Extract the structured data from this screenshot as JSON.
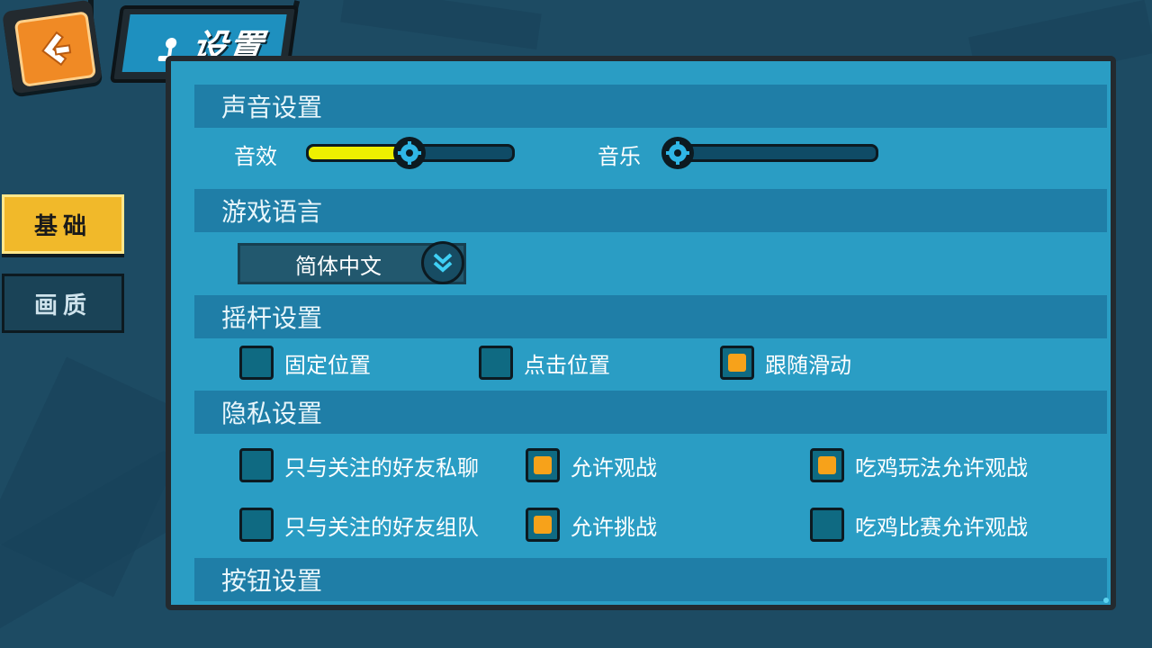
{
  "header": {
    "title": "设置",
    "back_icon": "back-arrow-icon",
    "title_icon": "joystick-icon"
  },
  "tabs": [
    {
      "label": "基础",
      "active": true
    },
    {
      "label": "画质",
      "active": false
    }
  ],
  "sections": {
    "sound": {
      "title": "声音设置",
      "effects_label": "音效",
      "effects_value": 0.48,
      "music_label": "音乐",
      "music_value": 0.0
    },
    "language": {
      "title": "游戏语言",
      "selected": "简体中文"
    },
    "joystick": {
      "title": "摇杆设置",
      "options": [
        {
          "label": "固定位置",
          "checked": false
        },
        {
          "label": "点击位置",
          "checked": false
        },
        {
          "label": "跟随滑动",
          "checked": true
        }
      ]
    },
    "privacy": {
      "title": "隐私设置",
      "options": [
        {
          "label": "只与关注的好友私聊",
          "checked": false
        },
        {
          "label": "允许观战",
          "checked": true
        },
        {
          "label": "吃鸡玩法允许观战",
          "checked": true
        },
        {
          "label": "只与关注的好友组队",
          "checked": false
        },
        {
          "label": "允许挑战",
          "checked": true
        },
        {
          "label": "吃鸡比赛允许观战",
          "checked": false
        }
      ]
    },
    "buttons": {
      "title": "按钮设置"
    }
  },
  "colors": {
    "panel": "#2a9dc4",
    "section_bar": "#1f7ea7",
    "accent_yellow": "#eef000",
    "check_orange": "#f7a21a",
    "tab_active": "#f1b92a"
  }
}
